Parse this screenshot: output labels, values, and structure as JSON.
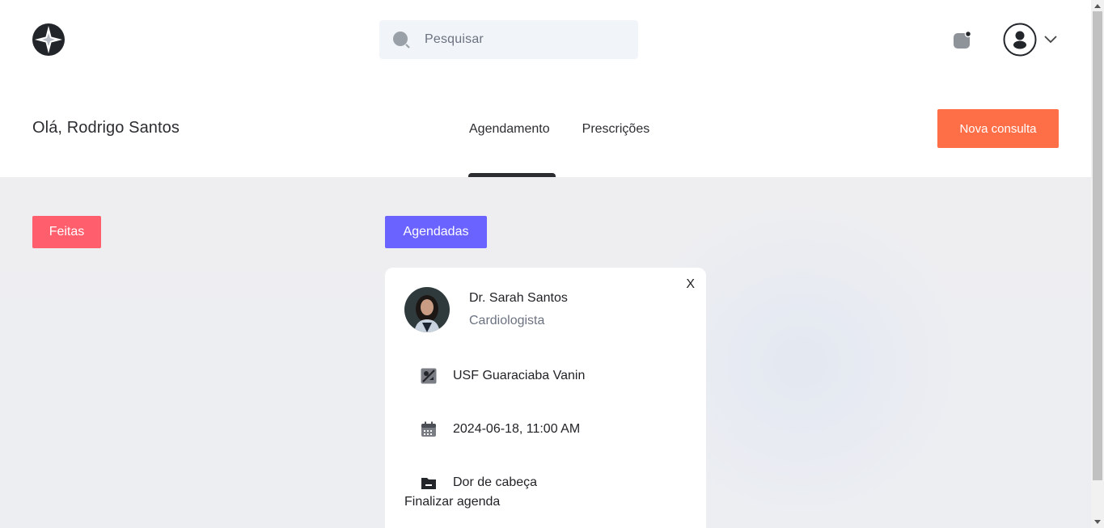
{
  "header": {
    "logo_icon": "compass-star-icon",
    "search_placeholder": "Pesquisar",
    "notification_icon": "bell-icon",
    "profile_icon": "user-circle-icon"
  },
  "subheader": {
    "greeting": "Olá, Rodrigo Santos",
    "tabs": [
      {
        "label": "Agendamento",
        "active": true
      },
      {
        "label": "Prescrições",
        "active": false
      }
    ],
    "new_button_label": "Nova consulta"
  },
  "filters": {
    "done_label": "Feitas",
    "scheduled_label": "Agendadas"
  },
  "appointment": {
    "close_label": "X",
    "doctor_name": "Dr. Sarah Santos",
    "specialty": "Cardiologista",
    "location": "USF Guaraciaba Vanin",
    "datetime": "2024-06-18, 11:00 AM",
    "reason": "Dor de cabeça",
    "finish_label": "Finalizar agenda"
  },
  "colors": {
    "accent_orange": "#ff6f47",
    "done_red": "#ff5e6c",
    "scheduled_purple": "#6a63ff"
  }
}
